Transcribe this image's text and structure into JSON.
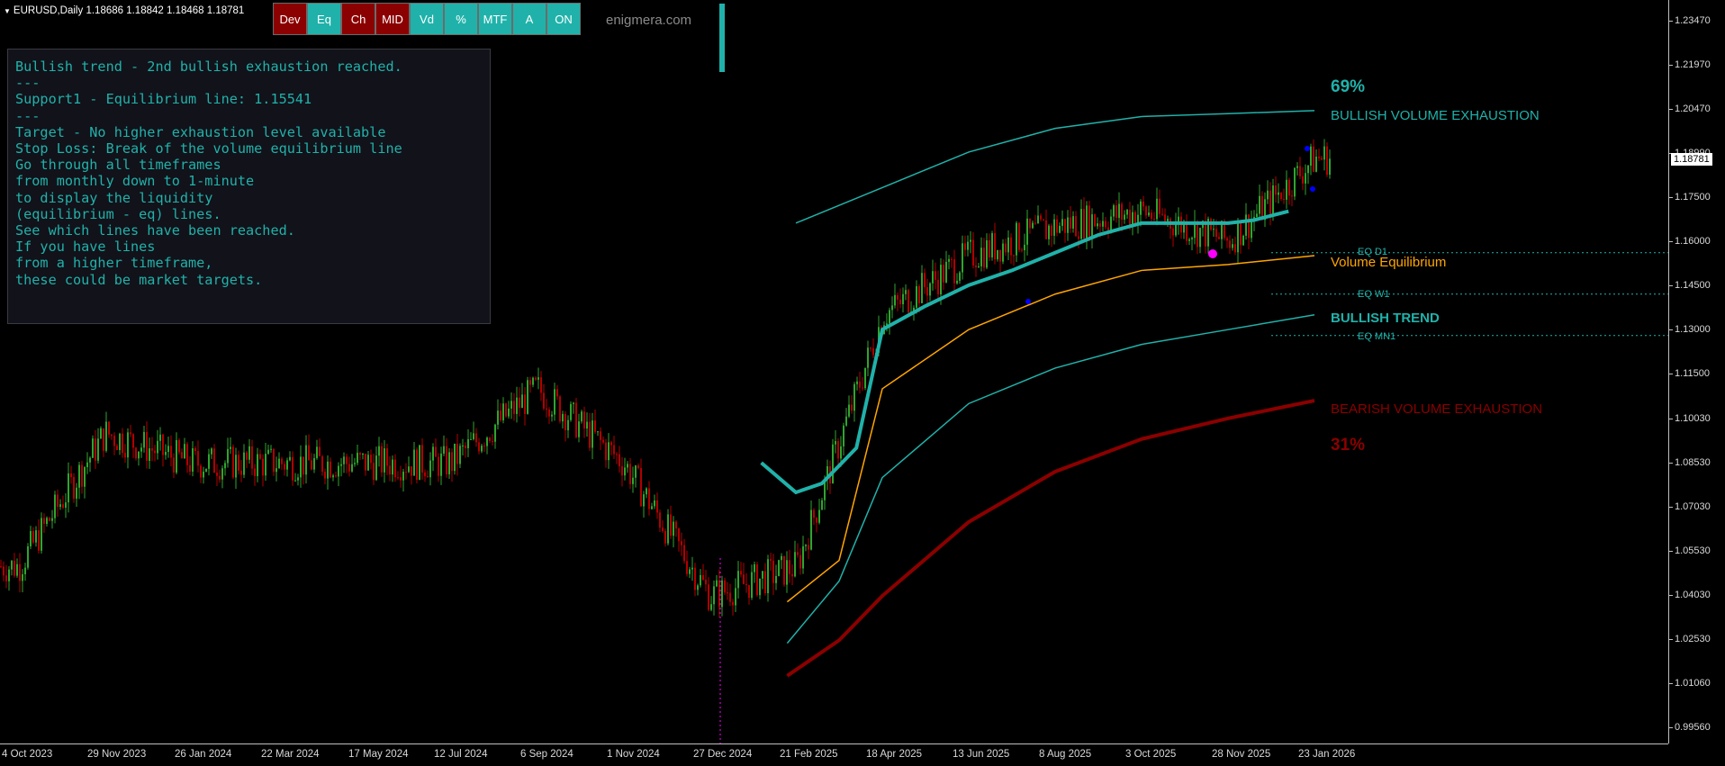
{
  "symbol": {
    "title": "EURUSD,Daily",
    "ohlc": "1.18686 1.18842 1.18468 1.18781"
  },
  "toolbar": {
    "buttons": [
      {
        "label": "Dev",
        "color": "#8b0000"
      },
      {
        "label": "Eq",
        "color": "#20b2aa"
      },
      {
        "label": "Ch",
        "color": "#8b0000"
      },
      {
        "label": "MID",
        "color": "#8b0000"
      },
      {
        "label": "Vd",
        "color": "#20b2aa"
      },
      {
        "label": "%",
        "color": "#20b2aa"
      },
      {
        "label": "MTF",
        "color": "#20b2aa"
      },
      {
        "label": "A",
        "color": "#20b2aa"
      },
      {
        "label": "ON",
        "color": "#20b2aa"
      }
    ]
  },
  "brand": "enigmera.com",
  "info_panel": {
    "lines": [
      "Bullish trend - 2nd bullish exhaustion reached.",
      "---",
      "Support1 - Equilibrium line: 1.15541",
      "---",
      "Target - No higher exhaustion level available",
      "Stop Loss: Break of the volume equilibrium line",
      "",
      "Go through all timeframes",
      "from monthly down to 1-minute",
      "to display the liquidity",
      "(equilibrium - eq) lines.",
      "See which lines have been reached.",
      "If you have lines",
      "from a higher timeframe,",
      "these could be market targets."
    ]
  },
  "labels": {
    "pct_top": "69%",
    "bullish_exhaustion": "BULLISH VOLUME EXHAUSTION",
    "volume_equilibrium": "Volume Equilibrium",
    "bullish_trend": "BULLISH TREND",
    "bearish_exhaustion": "BEARISH VOLUME EXHAUSTION",
    "pct_bottom": "31%",
    "eq_d1": "EQ D1",
    "eq_w1": "EQ W1",
    "eq_mn1": "EQ MN1"
  },
  "price_axis": {
    "ticks": [
      "1.23470",
      "1.21970",
      "1.20470",
      "1.18990",
      "1.17500",
      "1.16000",
      "1.14500",
      "1.13000",
      "1.11500",
      "1.10030",
      "1.08530",
      "1.07030",
      "1.05530",
      "1.04030",
      "1.02530",
      "1.01060",
      "0.99560"
    ],
    "current": "1.18781"
  },
  "time_axis": {
    "ticks": [
      "4 Oct 2023",
      "29 Nov 2023",
      "26 Jan 2024",
      "22 Mar 2024",
      "17 May 2024",
      "12 Jul 2024",
      "6 Sep 2024",
      "1 Nov 2024",
      "27 Dec 2024",
      "21 Feb 2025",
      "18 Apr 2025",
      "13 Jun 2025",
      "8 Aug 2025",
      "3 Oct 2025",
      "28 Nov 2025",
      "23 Jan 2026"
    ]
  },
  "colors": {
    "bull_candle": "#2fa52f",
    "bear_candle": "#b30000",
    "teal": "#20b2aa",
    "orange": "#ffa500",
    "dark_red": "#8b0000",
    "magenta": "#ff00ff",
    "blue": "#0000ff"
  },
  "chart_data": {
    "type": "candlestick",
    "symbol": "EURUSD",
    "timeframe": "Daily",
    "ylim": [
      0.9956,
      1.2347
    ],
    "x_ticks": [
      "4 Oct 2023",
      "29 Nov 2023",
      "26 Jan 2024",
      "22 Mar 2024",
      "17 May 2024",
      "12 Jul 2024",
      "6 Sep 2024",
      "1 Nov 2024",
      "27 Dec 2024",
      "21 Feb 2025",
      "18 Apr 2025",
      "13 Jun 2025",
      "8 Aug 2025",
      "3 Oct 2025",
      "28 Nov 2025",
      "23 Jan 2026"
    ],
    "close_path": [
      [
        "4 Oct 2023",
        1.05
      ],
      [
        "29 Nov 2023",
        1.095
      ],
      [
        "26 Jan 2024",
        1.085
      ],
      [
        "22 Mar 2024",
        1.085
      ],
      [
        "17 May 2024",
        1.085
      ],
      [
        "12 Jul 2024",
        1.085
      ],
      [
        "6 Sep 2024",
        1.11
      ],
      [
        "1 Nov 2024",
        1.085
      ],
      [
        "27 Dec 2024",
        1.04
      ],
      [
        "21 Feb 2025",
        1.05
      ],
      [
        "18 Apr 2025",
        1.135
      ],
      [
        "13 Jun 2025",
        1.155
      ],
      [
        "8 Aug 2025",
        1.165
      ],
      [
        "3 Oct 2025",
        1.17
      ],
      [
        "28 Nov 2025",
        1.16
      ],
      [
        "23 Jan 2026",
        1.188
      ]
    ],
    "series": [
      {
        "name": "BULLISH VOLUME EXHAUSTION",
        "values": [
          [
            9,
            1.166
          ],
          [
            10,
            1.178
          ],
          [
            11,
            1.19
          ],
          [
            12,
            1.198
          ],
          [
            13,
            1.202
          ],
          [
            14,
            1.203
          ],
          [
            15,
            1.204
          ]
        ]
      },
      {
        "name": "Volume Equilibrium",
        "values": [
          [
            8.9,
            1.038
          ],
          [
            9.5,
            1.052
          ],
          [
            10,
            1.11
          ],
          [
            11,
            1.13
          ],
          [
            12,
            1.142
          ],
          [
            13,
            1.15
          ],
          [
            14,
            1.152
          ],
          [
            15,
            1.155
          ]
        ]
      },
      {
        "name": "BULLISH TREND",
        "values": [
          [
            8.9,
            1.024
          ],
          [
            9.5,
            1.045
          ],
          [
            10,
            1.08
          ],
          [
            11,
            1.105
          ],
          [
            12,
            1.117
          ],
          [
            13,
            1.125
          ],
          [
            14,
            1.13
          ],
          [
            15,
            1.135
          ]
        ]
      },
      {
        "name": "BEARISH VOLUME EXHAUSTION",
        "values": [
          [
            8.9,
            1.013
          ],
          [
            9.5,
            1.025
          ],
          [
            10,
            1.04
          ],
          [
            11,
            1.065
          ],
          [
            12,
            1.082
          ],
          [
            13,
            1.093
          ],
          [
            14,
            1.1
          ],
          [
            15,
            1.106
          ]
        ]
      },
      {
        "name": "EQ D1",
        "values": [
          [
            14.5,
            1.156
          ]
        ]
      },
      {
        "name": "EQ W1",
        "values": [
          [
            14.5,
            1.142
          ]
        ]
      },
      {
        "name": "EQ MN1",
        "values": [
          [
            14.5,
            1.128
          ]
        ]
      }
    ]
  }
}
